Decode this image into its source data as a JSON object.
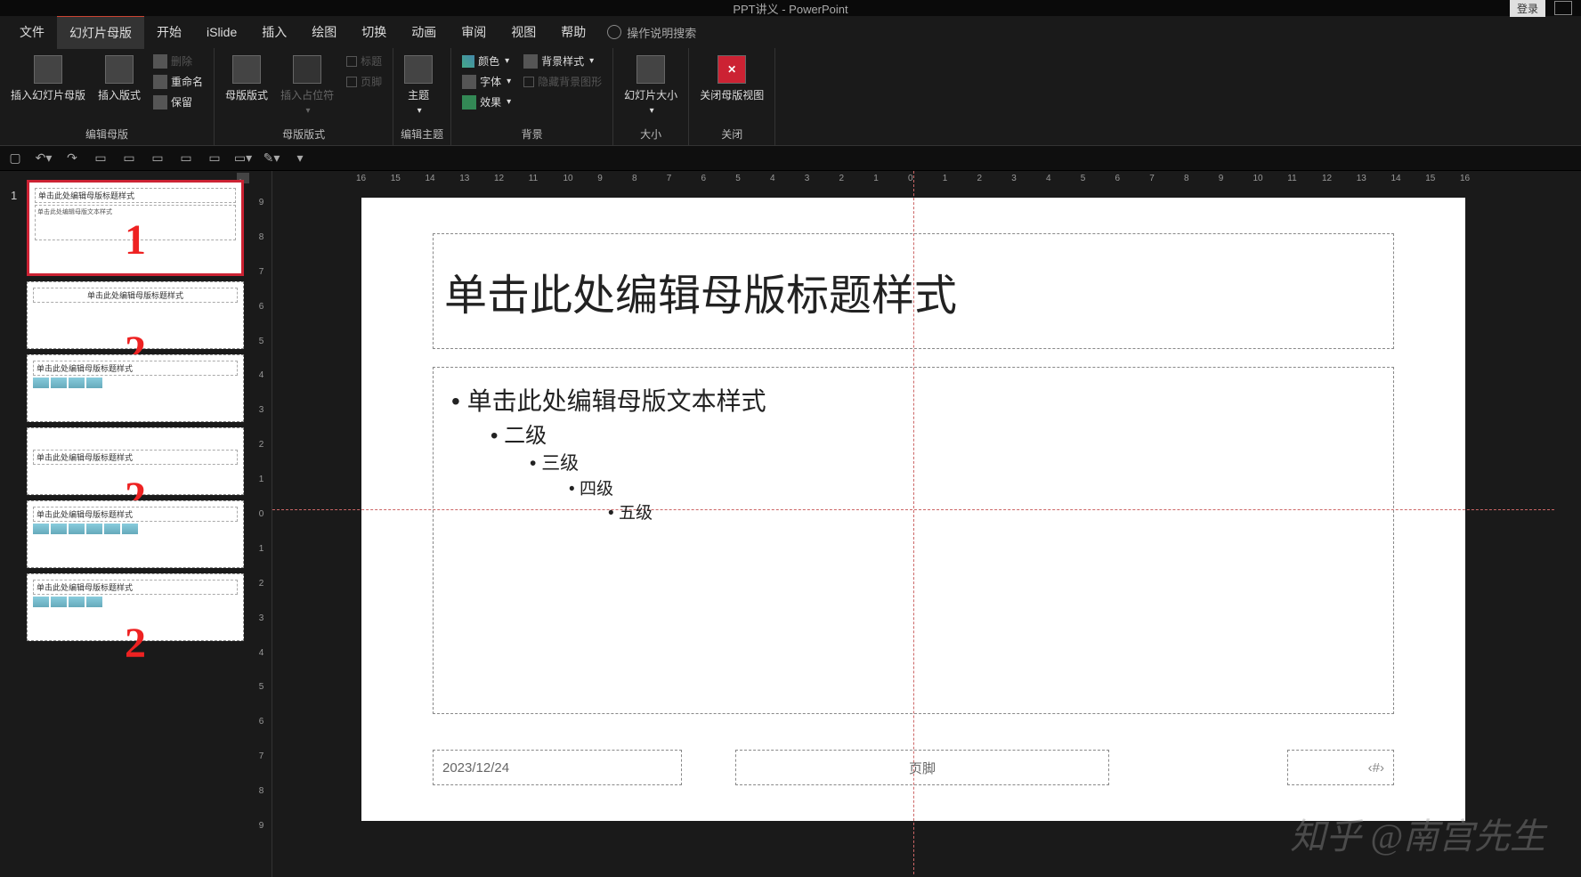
{
  "titlebar": {
    "title": "PPT讲义 - PowerPoint",
    "login": "登录"
  },
  "menu": {
    "items": [
      "文件",
      "幻灯片母版",
      "开始",
      "iSlide",
      "插入",
      "绘图",
      "切换",
      "动画",
      "审阅",
      "视图",
      "帮助"
    ],
    "active_index": 1,
    "tell_me": "操作说明搜索"
  },
  "ribbon": {
    "group_edit_master": {
      "label": "编辑母版",
      "insert_slide_master": "插入幻灯片母版",
      "insert_layout": "插入版式",
      "delete": "删除",
      "rename": "重命名",
      "preserve": "保留"
    },
    "group_master_layout": {
      "label": "母版版式",
      "master_layout": "母版版式",
      "insert_placeholder": "插入占位符",
      "title_cb": "标题",
      "footers_cb": "页脚"
    },
    "group_edit_theme": {
      "label": "编辑主题",
      "themes": "主题"
    },
    "group_background": {
      "label": "背景",
      "colors": "颜色",
      "fonts": "字体",
      "effects": "效果",
      "bg_styles": "背景样式",
      "hide_bg_graphics": "隐藏背景图形"
    },
    "group_size": {
      "label": "大小",
      "slide_size": "幻灯片大小"
    },
    "group_close": {
      "label": "关闭",
      "close_master": "关闭母版视图"
    }
  },
  "ruler": {
    "h": [
      "16",
      "15",
      "14",
      "13",
      "12",
      "11",
      "10",
      "9",
      "8",
      "7",
      "6",
      "5",
      "4",
      "3",
      "2",
      "1",
      "0",
      "1",
      "2",
      "3",
      "4",
      "5",
      "6",
      "7",
      "8",
      "9",
      "10",
      "11",
      "12",
      "13",
      "14",
      "15",
      "16"
    ],
    "v": [
      "9",
      "8",
      "7",
      "6",
      "5",
      "4",
      "3",
      "2",
      "1",
      "0",
      "1",
      "2",
      "3",
      "4",
      "5",
      "6",
      "7",
      "8",
      "9"
    ]
  },
  "thumbs": {
    "master_num": "1",
    "master_title": "单击此处编辑母版标题样式",
    "master_body": "单击此处编辑母版文本样式",
    "layout_title": "单击此处编辑母版标题样式",
    "layout_body_title": "单击此处编辑母版标题样式",
    "annot1": "1",
    "annot2": "2"
  },
  "slide": {
    "title": "单击此处编辑母版标题样式",
    "body_l1": "单击此处编辑母版文本样式",
    "body_l2": "二级",
    "body_l3": "三级",
    "body_l4": "四级",
    "body_l5": "五级",
    "date": "2023/12/24",
    "footer": "页脚",
    "pagenum": "‹#›"
  },
  "watermark": "知乎 @南宫先生"
}
